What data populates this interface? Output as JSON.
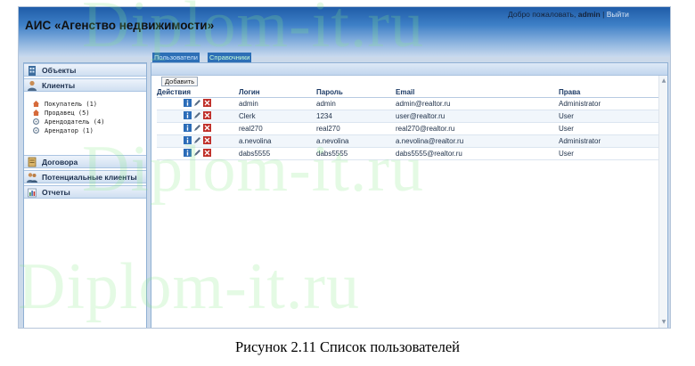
{
  "header": {
    "app_title": "АИС «Агенство недвижимости»",
    "welcome_text": "Добро пожаловать,",
    "username": "admin",
    "separator": "|",
    "logout_label": "Выйти"
  },
  "tabs": [
    {
      "label": "Пользователи"
    },
    {
      "label": "Справочники"
    }
  ],
  "sidebar": {
    "sections": [
      {
        "label": "Объекты",
        "icon": "building-icon"
      },
      {
        "label": "Клиенты",
        "icon": "person-icon"
      },
      {
        "label": "Договора",
        "icon": "contract-icon"
      },
      {
        "label": "Потенциальные клиенты",
        "icon": "people-icon"
      },
      {
        "label": "Отчеты",
        "icon": "report-icon"
      }
    ],
    "client_items": [
      {
        "label": "Покупатель (1)",
        "icon": "house-icon"
      },
      {
        "label": "Продавец (5)",
        "icon": "house-icon"
      },
      {
        "label": "Арендодатель (4)",
        "icon": "key-icon"
      },
      {
        "label": "Арендатор (1)",
        "icon": "key-icon"
      }
    ]
  },
  "toolbar": {
    "add_label": "Добавить"
  },
  "users_table": {
    "columns": [
      "Действия",
      "Логин",
      "Пароль",
      "Email",
      "Права"
    ],
    "rows": [
      {
        "login": "admin",
        "password": "admin",
        "email": "admin@realtor.ru",
        "rights": "Administrator"
      },
      {
        "login": "Clerk",
        "password": "1234",
        "email": "user@realtor.ru",
        "rights": "User"
      },
      {
        "login": "real270",
        "password": "real270",
        "email": "real270@realtor.ru",
        "rights": "User"
      },
      {
        "login": "a.nevolina",
        "password": "a.nevolina",
        "email": "a.nevolina@realtor.ru",
        "rights": "Administrator"
      },
      {
        "login": "dabs5555",
        "password": "dabs5555",
        "email": "dabs5555@realtor.ru",
        "rights": "User"
      }
    ]
  },
  "caption": "Рисунок 2.11 Список пользователей",
  "watermark": "Diplom-it.ru",
  "colors": {
    "header_dark": "#1f5ca8",
    "panel_bg": "#cbd9ea",
    "info_icon": "#2b6cb8",
    "delete_icon": "#c0302a",
    "watermark": "#82e682"
  }
}
